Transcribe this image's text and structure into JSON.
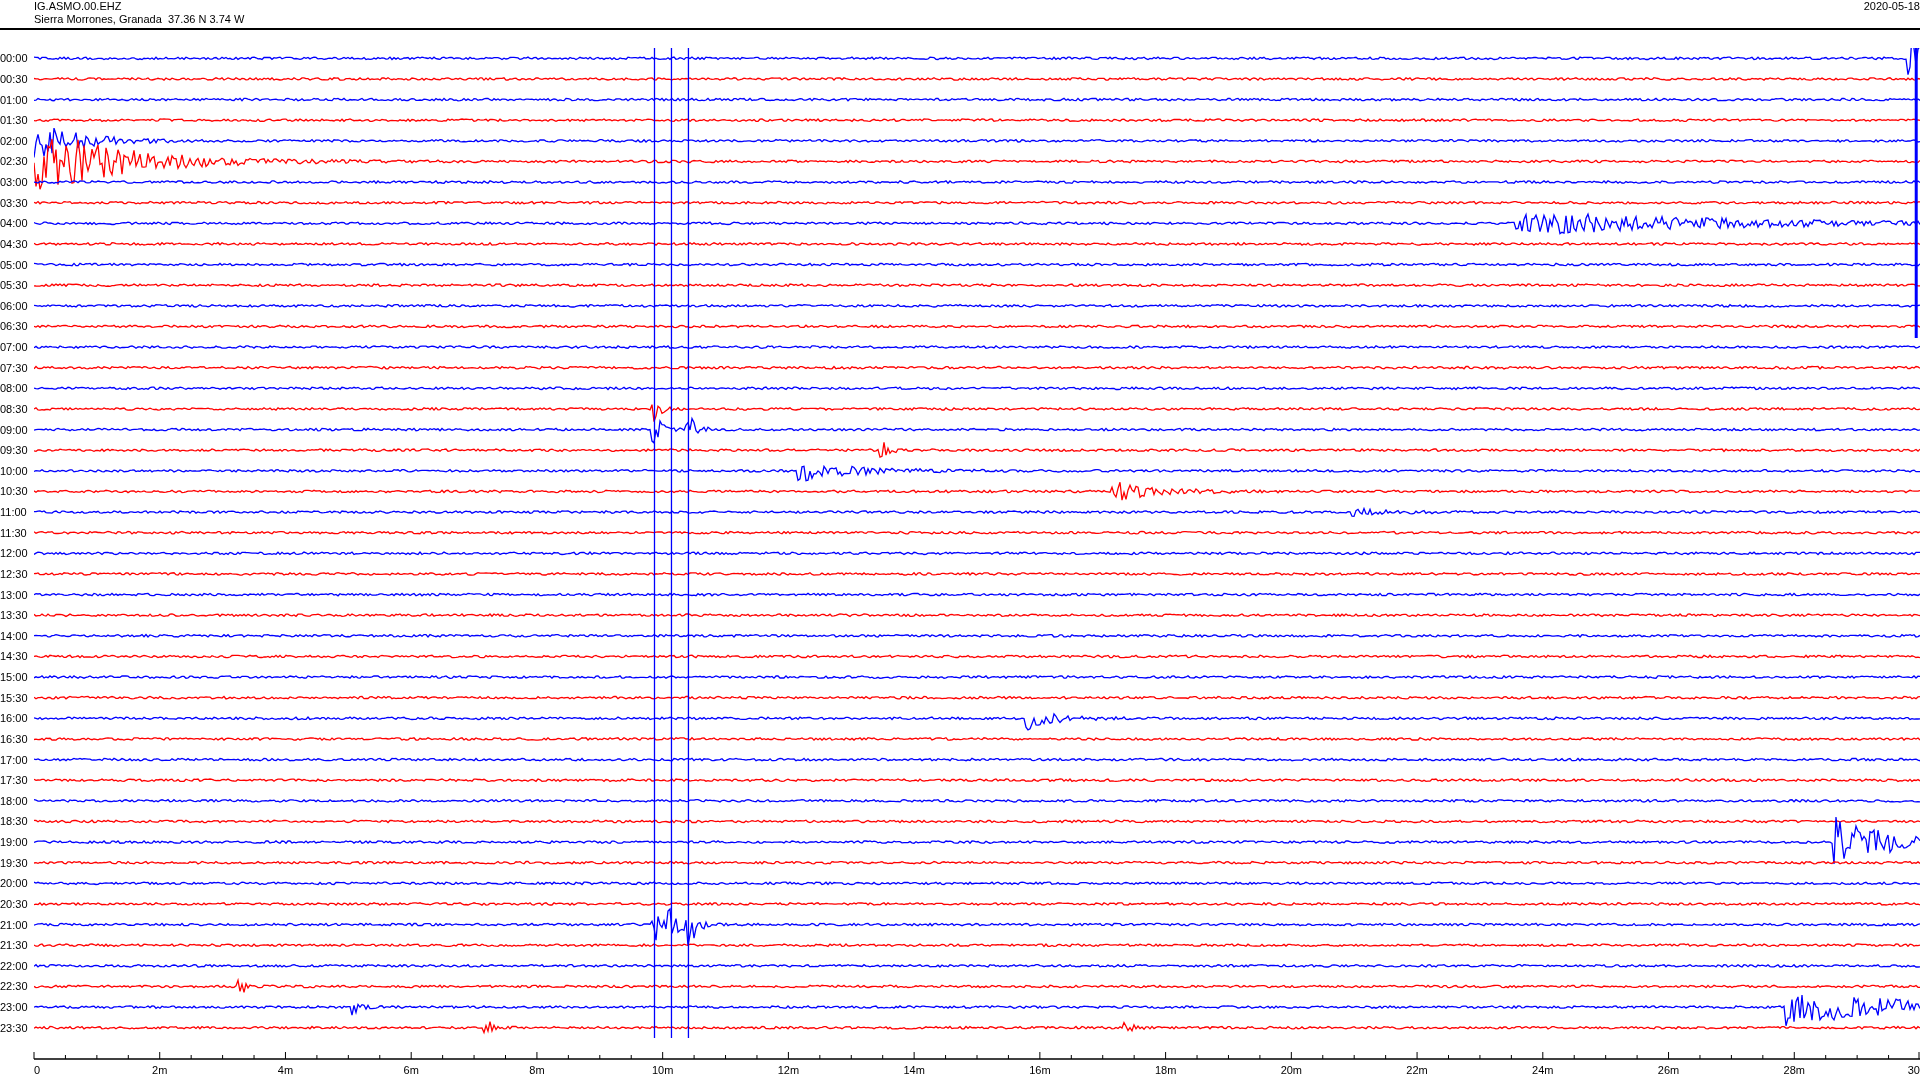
{
  "header": {
    "station": "IG.ASMO.00.EHZ",
    "location": "Sierra Morrones, Granada  37.36 N 3.74 W",
    "date": "2020-05-18"
  },
  "rows": [
    {
      "label": "00:00",
      "color": "#0000ff"
    },
    {
      "label": "00:30",
      "color": "#ff0000"
    },
    {
      "label": "01:00",
      "color": "#0000ff"
    },
    {
      "label": "01:30",
      "color": "#ff0000"
    },
    {
      "label": "02:00",
      "color": "#0000ff"
    },
    {
      "label": "02:30",
      "color": "#ff0000"
    },
    {
      "label": "03:00",
      "color": "#0000ff"
    },
    {
      "label": "03:30",
      "color": "#ff0000"
    },
    {
      "label": "04:00",
      "color": "#0000ff"
    },
    {
      "label": "04:30",
      "color": "#ff0000"
    },
    {
      "label": "05:00",
      "color": "#0000ff"
    },
    {
      "label": "05:30",
      "color": "#ff0000"
    },
    {
      "label": "06:00",
      "color": "#0000ff"
    },
    {
      "label": "06:30",
      "color": "#ff0000"
    },
    {
      "label": "07:00",
      "color": "#0000ff"
    },
    {
      "label": "07:30",
      "color": "#ff0000"
    },
    {
      "label": "08:00",
      "color": "#0000ff"
    },
    {
      "label": "08:30",
      "color": "#ff0000"
    },
    {
      "label": "09:00",
      "color": "#0000ff"
    },
    {
      "label": "09:30",
      "color": "#ff0000"
    },
    {
      "label": "10:00",
      "color": "#0000ff"
    },
    {
      "label": "10:30",
      "color": "#ff0000"
    },
    {
      "label": "11:00",
      "color": "#0000ff"
    },
    {
      "label": "11:30",
      "color": "#ff0000"
    },
    {
      "label": "12:00",
      "color": "#0000ff"
    },
    {
      "label": "12:30",
      "color": "#ff0000"
    },
    {
      "label": "13:00",
      "color": "#0000ff"
    },
    {
      "label": "13:30",
      "color": "#ff0000"
    },
    {
      "label": "14:00",
      "color": "#0000ff"
    },
    {
      "label": "14:30",
      "color": "#ff0000"
    },
    {
      "label": "15:00",
      "color": "#0000ff"
    },
    {
      "label": "15:30",
      "color": "#ff0000"
    },
    {
      "label": "16:00",
      "color": "#0000ff"
    },
    {
      "label": "16:30",
      "color": "#ff0000"
    },
    {
      "label": "17:00",
      "color": "#0000ff"
    },
    {
      "label": "17:30",
      "color": "#ff0000"
    },
    {
      "label": "18:00",
      "color": "#0000ff"
    },
    {
      "label": "18:30",
      "color": "#ff0000"
    },
    {
      "label": "19:00",
      "color": "#0000ff"
    },
    {
      "label": "19:30",
      "color": "#ff0000"
    },
    {
      "label": "20:00",
      "color": "#0000ff"
    },
    {
      "label": "20:30",
      "color": "#ff0000"
    },
    {
      "label": "21:00",
      "color": "#0000ff"
    },
    {
      "label": "21:30",
      "color": "#ff0000"
    },
    {
      "label": "22:00",
      "color": "#0000ff"
    },
    {
      "label": "22:30",
      "color": "#ff0000"
    },
    {
      "label": "23:00",
      "color": "#0000ff"
    },
    {
      "label": "23:30",
      "color": "#ff0000"
    }
  ],
  "x_axis": {
    "labels": [
      "0",
      "2m",
      "4m",
      "6m",
      "8m",
      "10m",
      "12m",
      "14m",
      "16m",
      "18m",
      "20m",
      "22m",
      "24m",
      "26m",
      "28m",
      "30"
    ]
  }
}
